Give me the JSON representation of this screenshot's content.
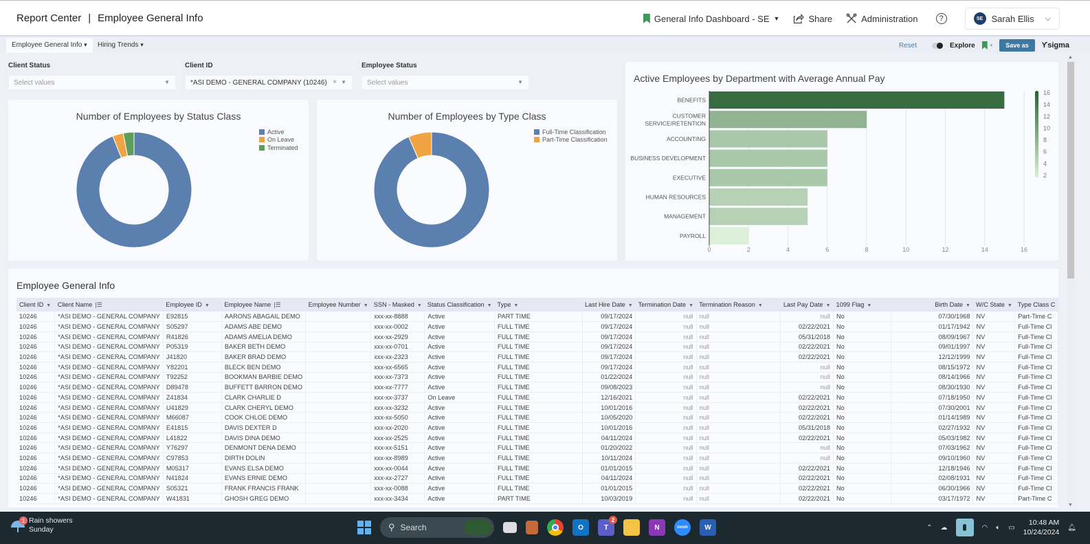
{
  "header": {
    "app_name": "Report Center",
    "separator": "|",
    "page_title": "Employee General Info",
    "bookmark_label": "General Info Dashboard - SE",
    "share_label": "Share",
    "administration_label": "Administration",
    "help_label": "?",
    "user_initials": "SE",
    "user_name": "Sarah Ellis"
  },
  "toolbar": {
    "tabs": [
      {
        "label": "Employee General Info",
        "active": true
      },
      {
        "label": "Hiring Trends",
        "active": false
      }
    ],
    "reset_label": "Reset",
    "explore_label": "Explore",
    "save_as_label": "Save as",
    "brand_label": "sigma"
  },
  "filters": [
    {
      "label": "Client Status",
      "value": "",
      "placeholder": "Select values"
    },
    {
      "label": "Client ID",
      "value": "*ASI DEMO - GENERAL COMPANY (10246)",
      "placeholder": "Select values"
    },
    {
      "label": "Employee Status",
      "value": "",
      "placeholder": "Select values"
    }
  ],
  "colors": {
    "blue": "#5b7fae",
    "orange": "#f0a342",
    "green": "#5d9e5d",
    "accent": "#3e79a6"
  },
  "chart_data": [
    {
      "type": "pie",
      "title": "Number of Employees by Status Class",
      "donut": true,
      "legend_position": "top-right",
      "categories": [
        "Active",
        "On Leave",
        "Terminated"
      ],
      "values": [
        94,
        3,
        3
      ],
      "unit": "percent (estimated)",
      "colors": [
        "#5b7fae",
        "#f0a342",
        "#5d9e5d"
      ]
    },
    {
      "type": "pie",
      "title": "Number of Employees by Type Class",
      "donut": true,
      "legend_position": "top-right",
      "categories": [
        "Full-Time Classification",
        "Part-Time Classification"
      ],
      "values": [
        93.5,
        6.5
      ],
      "unit": "percent (estimated)",
      "colors": [
        "#5b7fae",
        "#f0a342"
      ]
    },
    {
      "type": "bar",
      "orientation": "horizontal",
      "title": "Active Employees by Department with Average Annual Pay",
      "categories": [
        "BENEFITS",
        "CUSTOMER SERVICE/RETENTION",
        "ACCOUNTING",
        "BUSINESS DEVELOPMENT",
        "EXECUTIVE",
        "HUMAN RESOURCES",
        "MANAGEMENT",
        "PAYROLL"
      ],
      "values": [
        15,
        8,
        6,
        6,
        6,
        5,
        5,
        2
      ],
      "xlim": [
        0,
        16
      ],
      "xticks": [
        0,
        2,
        4,
        6,
        8,
        10,
        12,
        14,
        16
      ],
      "grid": true,
      "color_scale": {
        "min": 2,
        "max": 16,
        "ticks": [
          16,
          14,
          12,
          10,
          8,
          6,
          4,
          2
        ],
        "low_color": "#dcefd8",
        "high_color": "#2b6234"
      },
      "legend_position": "right"
    }
  ],
  "table": {
    "title": "Employee General Info",
    "columns": [
      {
        "label": "Client ID",
        "icon": "caret",
        "align": "left"
      },
      {
        "label": "Client Name",
        "icon": "sort",
        "align": "left"
      },
      {
        "label": "Employee ID",
        "icon": "caret",
        "align": "left"
      },
      {
        "label": "Employee Name",
        "icon": "sort",
        "align": "left"
      },
      {
        "label": "Employee Number",
        "icon": "caret",
        "align": "left"
      },
      {
        "label": "SSN - Masked",
        "icon": "caret",
        "align": "left"
      },
      {
        "label": "Status Classification",
        "icon": "caret",
        "align": "left"
      },
      {
        "label": "Type",
        "icon": "caret",
        "align": "left"
      },
      {
        "label": "Last Hire Date",
        "icon": "caret",
        "align": "right"
      },
      {
        "label": "Termination Date",
        "icon": "caret",
        "align": "right"
      },
      {
        "label": "Termination Reason",
        "icon": "caret",
        "align": "left"
      },
      {
        "label": "Last Pay Date",
        "icon": "caret",
        "align": "right"
      },
      {
        "label": "1099 Flag",
        "icon": "caret",
        "align": "left"
      },
      {
        "label": "Birth Date",
        "icon": "caret",
        "align": "right"
      },
      {
        "label": "W/C State",
        "icon": "caret",
        "align": "left"
      },
      {
        "label": "Type Class C",
        "icon": "none",
        "align": "left"
      }
    ],
    "rows": [
      [
        "10246",
        "*ASI DEMO - GENERAL COMPANY",
        "E92815",
        "AARONS ABAGAIL DEMO",
        "",
        "xxx-xx-8888",
        "Active",
        "PART TIME",
        "09/17/2024",
        "null",
        "null",
        "null",
        "No",
        "07/30/1968",
        "NV",
        "Part-Time C"
      ],
      [
        "10246",
        "*ASI DEMO - GENERAL COMPANY",
        "S05297",
        "ADAMS ABE DEMO",
        "",
        "xxx-xx-0002",
        "Active",
        "FULL TIME",
        "09/17/2024",
        "null",
        "null",
        "02/22/2021",
        "No",
        "01/17/1942",
        "NV",
        "Full-Time Cl"
      ],
      [
        "10246",
        "*ASI DEMO - GENERAL COMPANY",
        "R41826",
        "ADAMS AMELIA DEMO",
        "",
        "xxx-xx-2929",
        "Active",
        "FULL TIME",
        "09/17/2024",
        "null",
        "null",
        "05/31/2018",
        "No",
        "08/09/1967",
        "NV",
        "Full-Time Cl"
      ],
      [
        "10246",
        "*ASI DEMO - GENERAL COMPANY",
        "P05319",
        "BAKER BETH DEMO",
        "",
        "xxx-xx-0701",
        "Active",
        "FULL TIME",
        "09/17/2024",
        "null",
        "null",
        "02/22/2021",
        "No",
        "09/01/1997",
        "NV",
        "Full-Time Cl"
      ],
      [
        "10246",
        "*ASI DEMO - GENERAL COMPANY",
        "J41820",
        "BAKER BRAD DEMO",
        "",
        "xxx-xx-2323",
        "Active",
        "FULL TIME",
        "09/17/2024",
        "null",
        "null",
        "02/22/2021",
        "No",
        "12/12/1999",
        "NV",
        "Full-Time Cl"
      ],
      [
        "10246",
        "*ASI DEMO - GENERAL COMPANY",
        "Y82201",
        "BLECK BEN DEMO",
        "",
        "xxx-xx-6565",
        "Active",
        "FULL TIME",
        "09/17/2024",
        "null",
        "null",
        "null",
        "No",
        "08/15/1972",
        "NV",
        "Full-Time Cl"
      ],
      [
        "10246",
        "*ASI DEMO - GENERAL COMPANY",
        "T92252",
        "BOOKMAN BARBIE DEMO",
        "",
        "xxx-xx-7373",
        "Active",
        "FULL TIME",
        "01/22/2024",
        "null",
        "null",
        "null",
        "No",
        "08/14/1966",
        "NV",
        "Full-Time Cl"
      ],
      [
        "10246",
        "*ASI DEMO - GENERAL COMPANY",
        "D89478",
        "BUFFETT BARRON DEMO",
        "",
        "xxx-xx-7777",
        "Active",
        "FULL TIME",
        "09/08/2023",
        "null",
        "null",
        "null",
        "No",
        "08/30/1930",
        "NV",
        "Full-Time Cl"
      ],
      [
        "10246",
        "*ASI DEMO - GENERAL COMPANY",
        "Z41834",
        "CLARK CHARLIE D",
        "",
        "xxx-xx-3737",
        "On Leave",
        "FULL TIME",
        "12/16/2021",
        "null",
        "null",
        "02/22/2021",
        "No",
        "07/18/1950",
        "NV",
        "Full-Time Cl"
      ],
      [
        "10246",
        "*ASI DEMO - GENERAL COMPANY",
        "U41829",
        "CLARK CHERYL DEMO",
        "",
        "xxx-xx-3232",
        "Active",
        "FULL TIME",
        "10/01/2016",
        "null",
        "null",
        "02/22/2021",
        "No",
        "07/30/2001",
        "NV",
        "Full-Time Cl"
      ],
      [
        "10246",
        "*ASI DEMO - GENERAL COMPANY",
        "M66087",
        "COOK CHLOE DEMO",
        "",
        "xxx-xx-5050",
        "Active",
        "FULL TIME",
        "10/05/2020",
        "null",
        "null",
        "02/22/2021",
        "No",
        "01/14/1989",
        "NV",
        "Full-Time Cl"
      ],
      [
        "10246",
        "*ASI DEMO - GENERAL COMPANY",
        "E41815",
        "DAVIS DEXTER D",
        "",
        "xxx-xx-2020",
        "Active",
        "FULL TIME",
        "10/01/2016",
        "null",
        "null",
        "05/31/2018",
        "No",
        "02/27/1932",
        "NV",
        "Full-Time Cl"
      ],
      [
        "10246",
        "*ASI DEMO - GENERAL COMPANY",
        "L41822",
        "DAVIS DINA DEMO",
        "",
        "xxx-xx-2525",
        "Active",
        "FULL TIME",
        "04/11/2024",
        "null",
        "null",
        "02/22/2021",
        "No",
        "05/03/1982",
        "NV",
        "Full-Time Cl"
      ],
      [
        "10246",
        "*ASI DEMO - GENERAL COMPANY",
        "Y76297",
        "DENMONT DENA DEMO",
        "",
        "xxx-xx-5151",
        "Active",
        "FULL TIME",
        "01/20/2022",
        "null",
        "null",
        "null",
        "No",
        "07/03/1962",
        "NV",
        "Full-Time Cl"
      ],
      [
        "10246",
        "*ASI DEMO - GENERAL COMPANY",
        "C97853",
        "DIRTH DOLIN",
        "",
        "xxx-xx-8989",
        "Active",
        "FULL TIME",
        "10/11/2024",
        "null",
        "null",
        "null",
        "No",
        "09/10/1960",
        "NV",
        "Full-Time Cl"
      ],
      [
        "10246",
        "*ASI DEMO - GENERAL COMPANY",
        "M05317",
        "EVANS ELSA DEMO",
        "",
        "xxx-xx-0044",
        "Active",
        "FULL TIME",
        "01/01/2015",
        "null",
        "null",
        "02/22/2021",
        "No",
        "12/18/1946",
        "NV",
        "Full-Time Cl"
      ],
      [
        "10246",
        "*ASI DEMO - GENERAL COMPANY",
        "N41824",
        "EVANS ERNIE DEMO",
        "",
        "xxx-xx-2727",
        "Active",
        "FULL TIME",
        "04/11/2024",
        "null",
        "null",
        "02/22/2021",
        "No",
        "02/08/1931",
        "NV",
        "Full-Time Cl"
      ],
      [
        "10246",
        "*ASI DEMO - GENERAL COMPANY",
        "S05321",
        "FRANK FRANCIS FRANK",
        "",
        "xxx-xx-0088",
        "Active",
        "FULL TIME",
        "01/01/2015",
        "null",
        "null",
        "02/22/2021",
        "No",
        "06/30/1966",
        "NV",
        "Full-Time Cl"
      ],
      [
        "10246",
        "*ASI DEMO - GENERAL COMPANY",
        "W41831",
        "GHOSH GREG DEMO",
        "",
        "xxx-xx-3434",
        "Active",
        "PART TIME",
        "10/03/2019",
        "null",
        "null",
        "02/22/2021",
        "No",
        "03/17/1972",
        "NV",
        "Part-Time C"
      ]
    ]
  },
  "taskbar": {
    "weather_title": "Rain showers",
    "weather_sub": "Sunday",
    "weather_badge": "1",
    "search_label": "Search",
    "teams_badge": "2",
    "time": "10:48 AM",
    "date": "10/24/2024"
  }
}
